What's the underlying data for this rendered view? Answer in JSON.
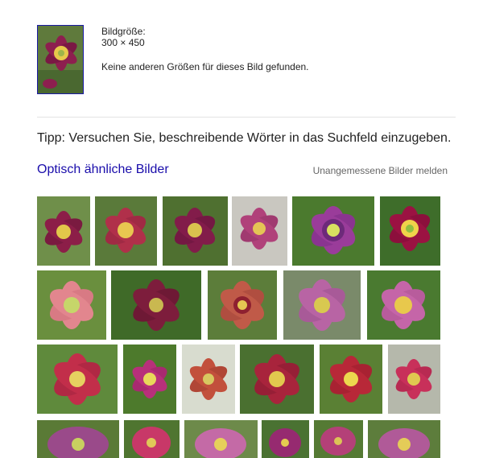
{
  "image_info": {
    "size_label": "Bildgröße:",
    "size_value": "300 × 450",
    "no_other_sizes": "Keine anderen Größen für dieses Bild gefunden."
  },
  "tip": "Tipp: Versuchen Sie, beschreibende Wörter in das Suchfeld einzugeben.",
  "similar": {
    "title": "Optisch ähnliche Bilder",
    "report_link": "Unangemessene Bilder melden"
  },
  "colors": {
    "link": "#1a0dab",
    "text": "#222222",
    "muted": "#666666"
  }
}
